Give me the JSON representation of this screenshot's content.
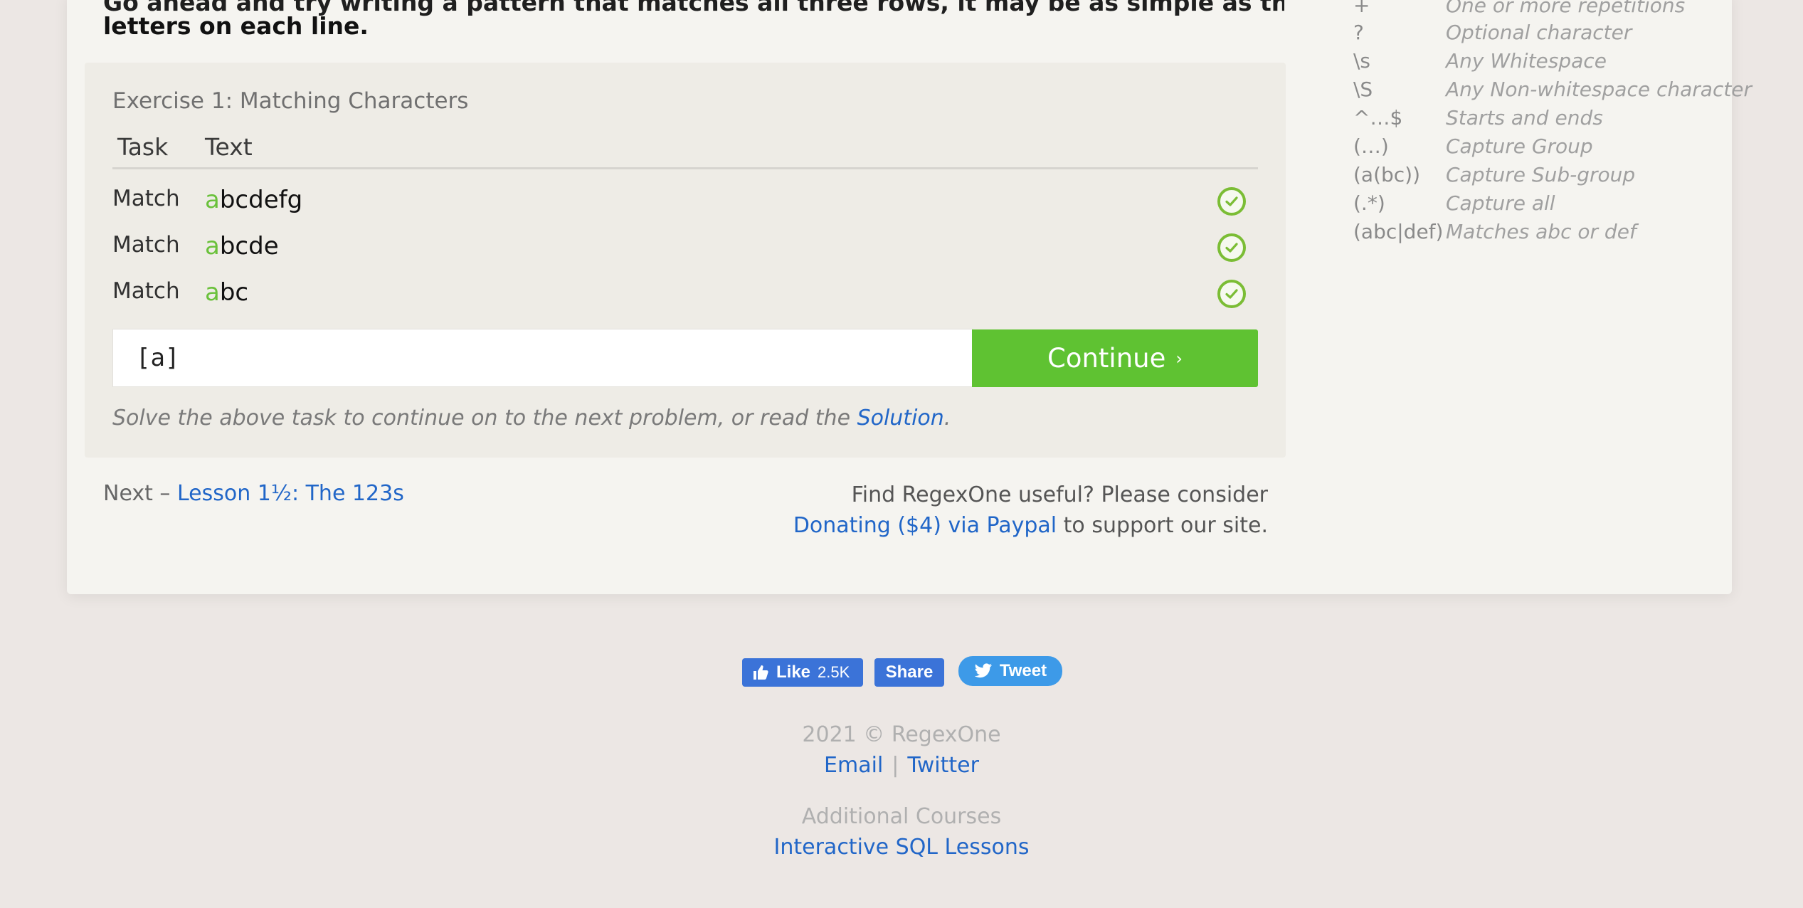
{
  "intro": {
    "partial_line": "Go ahead and try writing a pattern that matches all three rows, it may be as simple as the common",
    "last_line": "letters on each line."
  },
  "exercise": {
    "title": "Exercise 1: Matching Characters",
    "col_task": "Task",
    "col_text": "Text",
    "rows": [
      {
        "task": "Match",
        "match": "a",
        "rest": "bcdefg",
        "status": "check-icon"
      },
      {
        "task": "Match",
        "match": "a",
        "rest": "bcde",
        "status": "check-icon"
      },
      {
        "task": "Match",
        "match": "a",
        "rest": "bc",
        "status": "check-icon"
      }
    ],
    "input_value": "[a]",
    "continue_label": "Continue",
    "continue_chevron": "›",
    "solve_text": "Solve the above task to continue on to the next problem, or read the ",
    "solution_link": "Solution",
    "solve_end": "."
  },
  "nav": {
    "next_prefix": "Next –",
    "next_link": "Lesson 1½: The 123s"
  },
  "donate": {
    "line1": "Find RegexOne useful? Please consider",
    "link": "Donating ($4) via Paypal",
    "line2_end": " to support our site."
  },
  "reference": [
    {
      "symbol": "+",
      "desc": "One or more repetitions"
    },
    {
      "symbol": "?",
      "desc": "Optional character"
    },
    {
      "symbol": "\\s",
      "desc": "Any Whitespace"
    },
    {
      "symbol": "\\S",
      "desc": "Any Non-whitespace character"
    },
    {
      "symbol": "^…$",
      "desc": "Starts and ends"
    },
    {
      "symbol": "(…)",
      "desc": "Capture Group"
    },
    {
      "symbol": "(a(bc))",
      "desc": "Capture Sub-group"
    },
    {
      "symbol": "(.*)",
      "desc": "Capture all"
    },
    {
      "symbol": "(abc|def)",
      "desc": "Matches abc or def"
    }
  ],
  "social": {
    "like_label": "Like",
    "like_count": "2.5K",
    "share_label": "Share",
    "tweet_label": "Tweet"
  },
  "footer": {
    "copyright": "2021 © RegexOne",
    "email": "Email",
    "divider": "|",
    "twitter": "Twitter",
    "additional": "Additional Courses",
    "sql": "Interactive SQL Lessons"
  },
  "colors": {
    "accent_green": "#5fc232",
    "link_blue": "#2166c8",
    "facebook_blue": "#3b73d8",
    "twitter_blue": "#3d9ae8"
  }
}
